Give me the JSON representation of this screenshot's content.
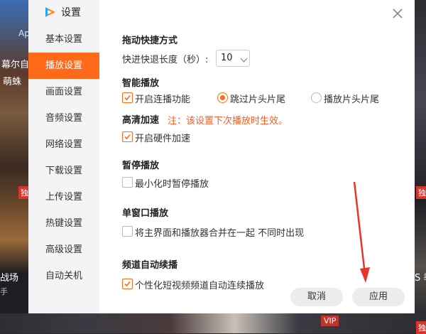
{
  "dialog": {
    "title": "设置",
    "close_icon": "close-icon"
  },
  "sidebar": {
    "items": [
      {
        "label": "基本设置",
        "active": false
      },
      {
        "label": "播放设置",
        "active": true
      },
      {
        "label": "画面设置",
        "active": false
      },
      {
        "label": "音频设置",
        "active": false
      },
      {
        "label": "网络设置",
        "active": false
      },
      {
        "label": "下载设置",
        "active": false
      },
      {
        "label": "上传设置",
        "active": false
      },
      {
        "label": "热键设置",
        "active": false
      },
      {
        "label": "高级设置",
        "active": false
      },
      {
        "label": "自动关机",
        "active": false
      }
    ]
  },
  "sections": {
    "drag_shortcut": {
      "title": "拖动快捷方式",
      "seek_label": "快进快退长度（秒）:",
      "seek_value": "10"
    },
    "smart_play": {
      "title": "智能播放",
      "continuous_label": "开启连播功能",
      "continuous_checked": true,
      "skip_label": "跳过片头片尾",
      "skip_selected": true,
      "play_label": "播放片头片尾",
      "play_selected": false
    },
    "hd_accel": {
      "title": "高清加速",
      "notice": "注：该设置下次播放时生效。",
      "hw_label": "开启硬件加速",
      "hw_checked": true
    },
    "pause": {
      "title": "暂停播放",
      "min_label": "最小化时暂停播放",
      "min_checked": false
    },
    "single_window": {
      "title": "单窗口播放",
      "merge_label": "将主界面和播放器合并在一起 不同时出现",
      "merge_checked": false
    },
    "channel_auto": {
      "title": "频道自动续播",
      "short_label": "个性化短视频频道自动连续播放",
      "short_checked": true
    }
  },
  "footer": {
    "cancel_label": "取消",
    "apply_label": "应用"
  },
  "background": {
    "left_texts": [
      "Ap",
      "幕尔自",
      "萌蛛",
      "独",
      "战场",
      "手"
    ],
    "right_texts": [
      "独",
      "S 季",
      "独"
    ],
    "vip_badge": "VIP"
  },
  "colors": {
    "accent": "#ff6a1a",
    "notice": "#ff5a1f",
    "arrow": "#e8342b"
  }
}
